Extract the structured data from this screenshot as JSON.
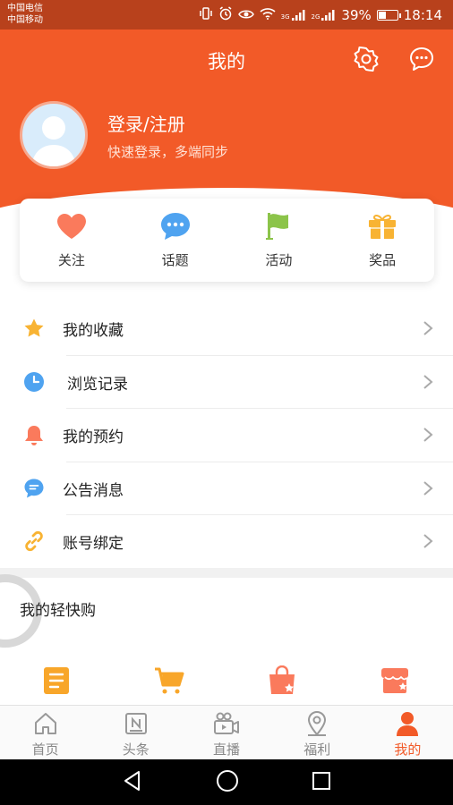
{
  "status_bar": {
    "carrier_1": "中国电信",
    "carrier_2": "中国移动",
    "network_1": "3G",
    "network_2": "2G",
    "battery": "39%",
    "time": "18:14"
  },
  "header": {
    "title": "我的",
    "login_title": "登录/注册",
    "login_subtitle": "快速登录，多端同步"
  },
  "quick_actions": [
    {
      "label": "关注",
      "icon": "heart-icon"
    },
    {
      "label": "话题",
      "icon": "chat-bubble-icon"
    },
    {
      "label": "活动",
      "icon": "flag-icon"
    },
    {
      "label": "奖品",
      "icon": "gift-icon"
    }
  ],
  "menu": [
    {
      "label": "我的收藏",
      "icon": "star-icon"
    },
    {
      "label": "浏览记录",
      "icon": "clock-icon"
    },
    {
      "label": "我的预约",
      "icon": "bell-icon"
    },
    {
      "label": "公告消息",
      "icon": "message-icon"
    },
    {
      "label": "账号绑定",
      "icon": "link-icon"
    }
  ],
  "shopping": {
    "title": "我的轻快购",
    "icons": [
      "order-list-icon",
      "cart-icon",
      "shopping-bag-icon",
      "store-icon"
    ]
  },
  "tabs": [
    {
      "label": "首页",
      "icon": "home-icon"
    },
    {
      "label": "头条",
      "icon": "news-icon"
    },
    {
      "label": "直播",
      "icon": "video-icon"
    },
    {
      "label": "福利",
      "icon": "location-icon"
    },
    {
      "label": "我的",
      "icon": "person-icon"
    }
  ],
  "colors": {
    "accent": "#f25a28",
    "status_bar": "#b8411c",
    "heart": "#fa7a5c",
    "topic": "#4fa3f0",
    "flag": "#8cc44a",
    "gift": "#f8b333"
  }
}
